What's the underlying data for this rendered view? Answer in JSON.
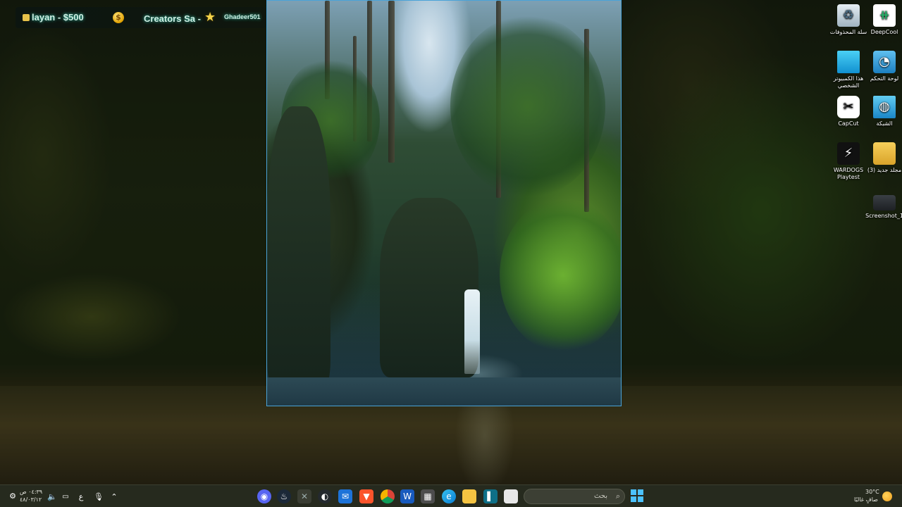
{
  "stream_overlay": {
    "donation_label": "layan - $500",
    "creator_label": "Creators Sa -",
    "user_label": "Ghadeer501"
  },
  "desktop_icons": [
    {
      "label": "DeepCool",
      "icon": "deepcool-icon"
    },
    {
      "label": "سلة المحذوفات",
      "icon": "recycle-bin-icon"
    },
    {
      "label": "لوحة التحكم",
      "icon": "control-panel-icon"
    },
    {
      "label": "هذا الكمبيوتر الشخصي",
      "icon": "this-pc-icon"
    },
    {
      "label": "الشبكة",
      "icon": "network-icon"
    },
    {
      "label": "CapCut",
      "icon": "capcut-icon"
    },
    {
      "label": "(3) مجلد جديد",
      "icon": "folder-icon"
    },
    {
      "label": "WARDOGS Playtest",
      "icon": "wardogs-icon"
    },
    {
      "label": "Screenshot_1",
      "icon": "screenshot-file-icon"
    }
  ],
  "taskbar": {
    "search_placeholder": "بحث",
    "weather": {
      "temperature": "30°C",
      "condition": "صافٍ غالبًا"
    },
    "clock": {
      "time": "٠٤:٣٩ ص",
      "date": "٤٨/٠٣/١٢"
    },
    "language": "ع",
    "pinned_apps": [
      "discord-icon",
      "steam-icon",
      "xbox-icon",
      "github-icon",
      "mail-icon",
      "brave-icon",
      "chrome-icon",
      "word-icon",
      "store-icon",
      "edge-icon",
      "file-explorer-icon",
      "app-icon",
      "task-view-icon"
    ]
  },
  "colors": {
    "selection_border": "#4aa3d8",
    "taskbar_bg": "#262a1e",
    "overlay_glow": "#3fe0c0"
  }
}
